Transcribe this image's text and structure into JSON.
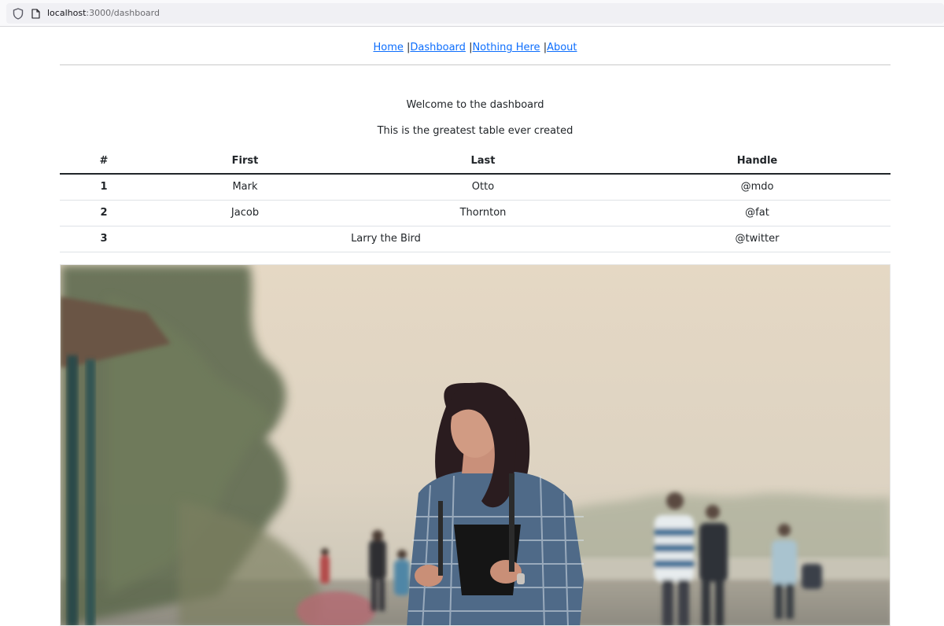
{
  "browser": {
    "url_host": "localhost",
    "url_path": ":3000/dashboard"
  },
  "nav": {
    "links": [
      "Home",
      "Dashboard",
      "Nothing Here",
      "About"
    ],
    "separator": "|"
  },
  "main": {
    "welcome": "Welcome to the dashboard",
    "subtitle": "This is the greatest table ever created"
  },
  "table": {
    "headers": [
      "#",
      "First",
      "Last",
      "Handle"
    ],
    "rows": [
      {
        "index": "1",
        "first": "Mark",
        "last": "Otto",
        "handle": "@mdo"
      },
      {
        "index": "2",
        "first": "Jacob",
        "last": "Thornton",
        "handle": "@fat"
      },
      {
        "index": "3",
        "first_last": "Larry the Bird",
        "handle": "@twitter"
      }
    ]
  },
  "colors": {
    "link": "#0d6efd",
    "text": "#212529",
    "table_border": "#dee2e6"
  },
  "icons": [
    "shield-icon",
    "page-icon"
  ]
}
